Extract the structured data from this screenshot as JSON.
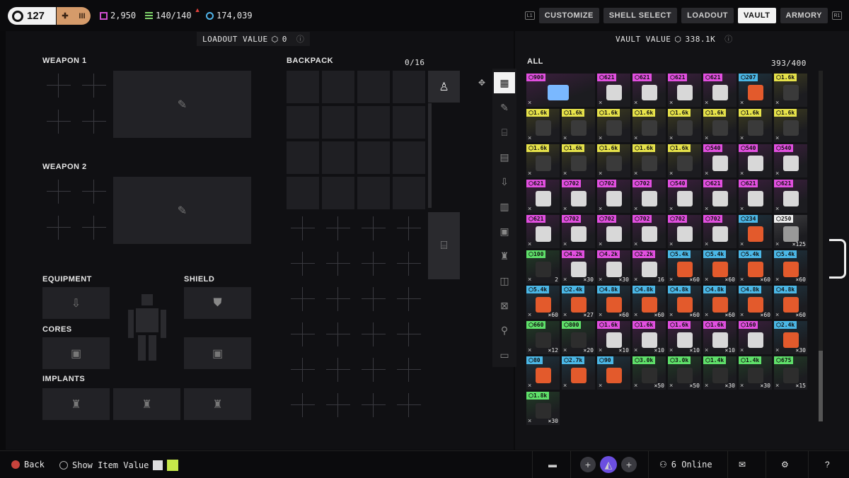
{
  "header": {
    "level": "127",
    "rank": "III",
    "currencies": [
      {
        "icon": "credits-icon",
        "value": "2,950",
        "color": "#d04fd0"
      },
      {
        "icon": "stack-icon",
        "value": "140/140",
        "color": "#7fd36b"
      },
      {
        "icon": "coin-icon",
        "value": "174,039",
        "color": "#4fb3e8"
      }
    ],
    "nav": {
      "l1": "L1",
      "r1": "R1",
      "tabs": [
        "CUSTOMIZE",
        "SHELL SELECT",
        "LOADOUT",
        "VAULT",
        "ARMORY"
      ],
      "active": "VAULT"
    }
  },
  "loadout": {
    "value_label": "LOADOUT VALUE",
    "value": "0",
    "weapon1": "WEAPON 1",
    "weapon2": "WEAPON 2",
    "equipment": "EQUIPMENT",
    "shield": "SHIELD",
    "cores": "CORES",
    "implants": "IMPLANTS",
    "backpack": "BACKPACK",
    "backpack_count": "0/16"
  },
  "vault": {
    "value_label": "VAULT VALUE",
    "value": "338.1K",
    "filter": "ALL",
    "count": "393/400",
    "colors": {
      "pink": "#e24fe0",
      "yellow": "#e6e24a",
      "blue": "#4bb7e6",
      "green": "#5fe06a"
    },
    "items": [
      {
        "price": "900",
        "tier": "pink"
      },
      {
        "price": "621",
        "tier": "pink"
      },
      {
        "price": "621",
        "tier": "pink"
      },
      {
        "price": "621",
        "tier": "pink"
      },
      {
        "price": "621",
        "tier": "pink"
      },
      {
        "price": "207",
        "tier": "blue"
      },
      {
        "price": "1.6k",
        "tier": "yellow"
      },
      {
        "price": "1.6k",
        "tier": "yellow"
      },
      {
        "price": "1.6k",
        "tier": "yellow"
      },
      {
        "price": "1.6k",
        "tier": "yellow"
      },
      {
        "price": "1.6k",
        "tier": "yellow"
      },
      {
        "price": "1.6k",
        "tier": "yellow"
      },
      {
        "price": "1.6k",
        "tier": "yellow"
      },
      {
        "price": "1.6k",
        "tier": "yellow"
      },
      {
        "price": "1.6k",
        "tier": "yellow"
      },
      {
        "price": "1.6k",
        "tier": "yellow"
      },
      {
        "price": "1.6k",
        "tier": "yellow"
      },
      {
        "price": "1.6k",
        "tier": "yellow"
      },
      {
        "price": "1.6k",
        "tier": "yellow"
      },
      {
        "price": "1.6k",
        "tier": "yellow"
      },
      {
        "price": "540",
        "tier": "pink"
      },
      {
        "price": "540",
        "tier": "pink"
      },
      {
        "price": "540",
        "tier": "pink"
      },
      {
        "price": "621",
        "tier": "pink"
      },
      {
        "price": "702",
        "tier": "pink"
      },
      {
        "price": "702",
        "tier": "pink"
      },
      {
        "price": "702",
        "tier": "pink"
      },
      {
        "price": "540",
        "tier": "pink"
      },
      {
        "price": "621",
        "tier": "pink"
      },
      {
        "price": "621",
        "tier": "pink"
      },
      {
        "price": "621",
        "tier": "pink"
      },
      {
        "price": "621",
        "tier": "pink"
      },
      {
        "price": "702",
        "tier": "pink"
      },
      {
        "price": "702",
        "tier": "pink"
      },
      {
        "price": "702",
        "tier": "pink"
      },
      {
        "price": "702",
        "tier": "pink"
      },
      {
        "price": "702",
        "tier": "pink"
      },
      {
        "price": "234",
        "tier": "blue"
      },
      {
        "price": "250",
        "tier": "white",
        "qty": "×125"
      },
      {
        "price": "100",
        "tier": "green",
        "qty": "2"
      },
      {
        "price": "4.2k",
        "tier": "pink",
        "qty": "×30"
      },
      {
        "price": "4.2k",
        "tier": "pink",
        "qty": "×30"
      },
      {
        "price": "2.2k",
        "tier": "pink",
        "qty": "16"
      },
      {
        "price": "5.4k",
        "tier": "blue",
        "qty": "×60"
      },
      {
        "price": "5.4k",
        "tier": "blue",
        "qty": "×60"
      },
      {
        "price": "5.4k",
        "tier": "blue",
        "qty": "×60"
      },
      {
        "price": "5.4k",
        "tier": "blue",
        "qty": "×60"
      },
      {
        "price": "5.4k",
        "tier": "blue",
        "qty": "×60"
      },
      {
        "price": "2.4k",
        "tier": "blue",
        "qty": "×27"
      },
      {
        "price": "4.8k",
        "tier": "blue",
        "qty": "×60"
      },
      {
        "price": "4.8k",
        "tier": "blue",
        "qty": "×60"
      },
      {
        "price": "4.8k",
        "tier": "blue",
        "qty": "×60"
      },
      {
        "price": "4.8k",
        "tier": "blue",
        "qty": "×60"
      },
      {
        "price": "4.8k",
        "tier": "blue",
        "qty": "×60"
      },
      {
        "price": "4.8k",
        "tier": "blue",
        "qty": "×60"
      },
      {
        "price": "660",
        "tier": "green",
        "qty": "×12"
      },
      {
        "price": "800",
        "tier": "green",
        "qty": "×20"
      },
      {
        "price": "1.6k",
        "tier": "pink",
        "qty": "×10"
      },
      {
        "price": "1.6k",
        "tier": "pink",
        "qty": "×10"
      },
      {
        "price": "1.6k",
        "tier": "pink",
        "qty": "×10"
      },
      {
        "price": "1.6k",
        "tier": "pink",
        "qty": "×10"
      },
      {
        "price": "160",
        "tier": "pink",
        "qty": ""
      },
      {
        "price": "2.4k",
        "tier": "blue",
        "qty": "×30"
      },
      {
        "price": "80",
        "tier": "blue",
        "qty": ""
      },
      {
        "price": "2.7k",
        "tier": "blue",
        "qty": ""
      },
      {
        "price": "90",
        "tier": "blue",
        "qty": ""
      },
      {
        "price": "3.0k",
        "tier": "green",
        "qty": "×50"
      },
      {
        "price": "3.0k",
        "tier": "green",
        "qty": "×50"
      },
      {
        "price": "1.4k",
        "tier": "green",
        "qty": "×30"
      },
      {
        "price": "1.4k",
        "tier": "green",
        "qty": "×30"
      },
      {
        "price": "675",
        "tier": "green",
        "qty": "×15"
      },
      {
        "price": "1.8k",
        "tier": "green",
        "qty": "×30"
      }
    ]
  },
  "footer": {
    "back": "Back",
    "show_value": "Show Item Value",
    "online": "6 Online",
    "help": "?"
  }
}
